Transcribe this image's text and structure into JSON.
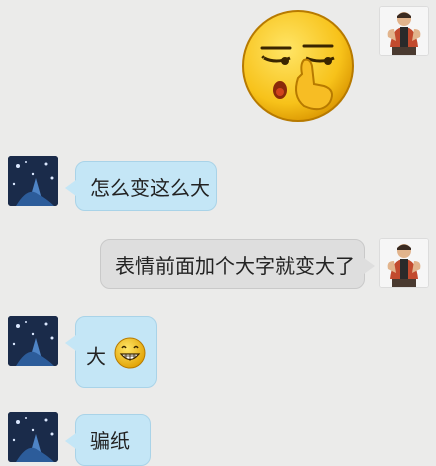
{
  "chat": {
    "messages": [
      {
        "sender": "me",
        "type": "sticker",
        "icon": "smirk-emoji-icon"
      },
      {
        "sender": "friend",
        "type": "text",
        "text": "怎么变这么大"
      },
      {
        "sender": "me",
        "type": "text",
        "text": "表情前面加个大字就变大了"
      },
      {
        "sender": "friend",
        "type": "text",
        "text": "大",
        "icon": "grin-emoji-icon"
      },
      {
        "sender": "friend",
        "type": "text",
        "text": "骗纸"
      }
    ]
  },
  "colors": {
    "background": "#ebebea",
    "incoming_bubble": "#c4e6f6",
    "outgoing_bubble": "#dedede"
  }
}
